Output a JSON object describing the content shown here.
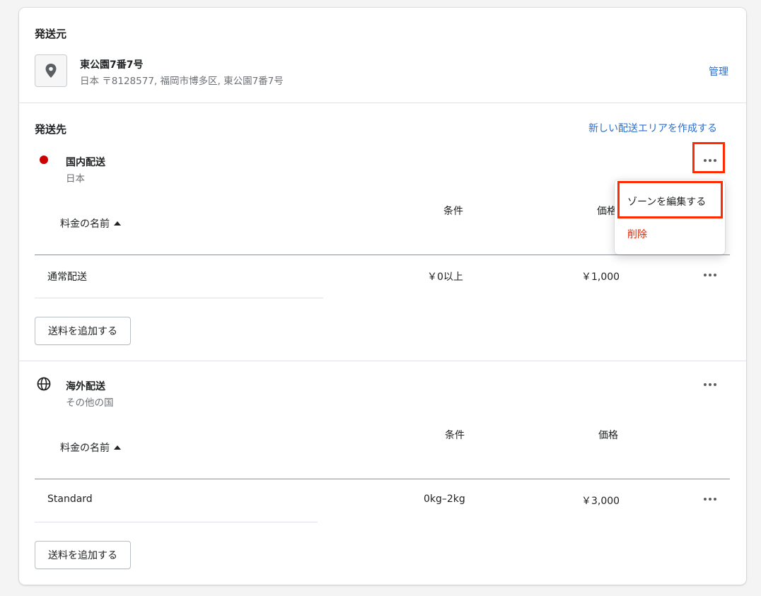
{
  "origin": {
    "heading": "発送元",
    "location_name": "東公園7番7号",
    "address": "日本 〒8128577, 福岡市博多区, 東公園7番7号",
    "manage_link": "管理"
  },
  "destination": {
    "heading": "発送先",
    "create_zone_link": "新しい配送エリアを作成する"
  },
  "zones": [
    {
      "name": "国内配送",
      "subtitle": "日本",
      "columns": {
        "rate_name": "料金の名前",
        "condition": "条件",
        "price": "価格"
      },
      "rates": [
        {
          "name": "通常配送",
          "condition": "￥0以上",
          "price": "￥1,000"
        }
      ],
      "add_rate_label": "送料を追加する"
    },
    {
      "name": "海外配送",
      "subtitle": "その他の国",
      "columns": {
        "rate_name": "料金の名前",
        "condition": "条件",
        "price": "価格"
      },
      "rates": [
        {
          "name": "Standard",
          "condition": "0kg–2kg",
          "price": "￥3,000"
        }
      ],
      "add_rate_label": "送料を追加する"
    }
  ],
  "zone_menu": {
    "edit_label": "ゾーンを編集する",
    "delete_label": "削除"
  },
  "colors": {
    "accent_link": "#2c6ecb",
    "danger": "#d72c0d",
    "highlight": "#ff2a00",
    "zone_marker": "#cc0000"
  },
  "icons": {
    "origin": "map-pin-icon",
    "zone_domestic": "red-dot-icon",
    "zone_international": "globe-icon",
    "menu": "ellipsis-icon",
    "sort": "caret-up-icon"
  }
}
